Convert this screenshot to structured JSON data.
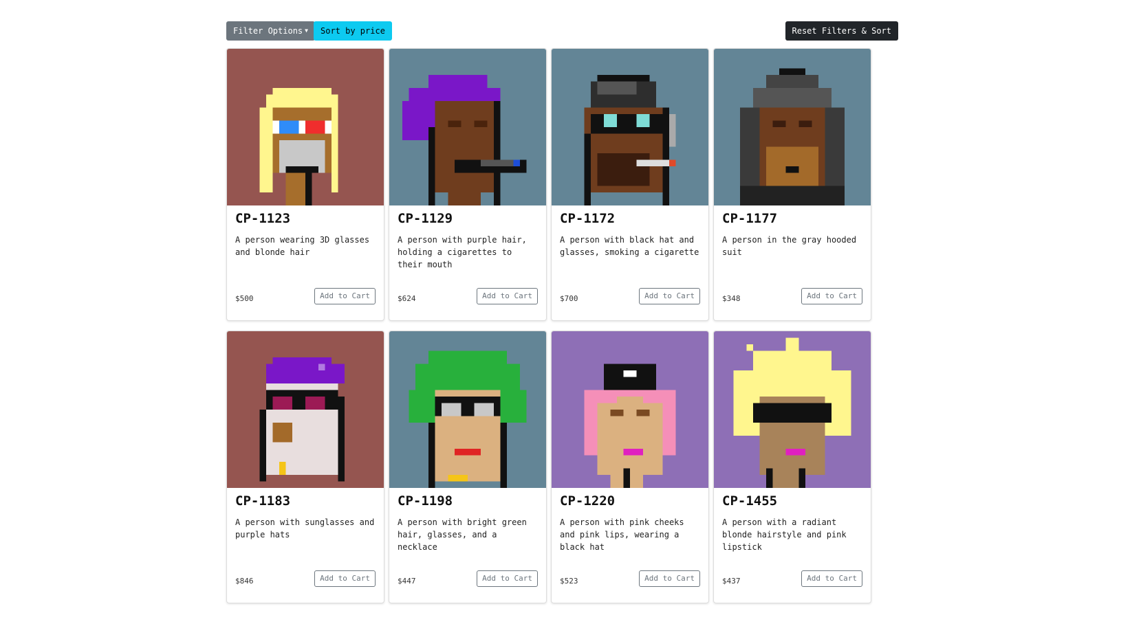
{
  "toolbar": {
    "filter_label": "Filter Options",
    "sort_label": "Sort by price",
    "reset_label": "Reset Filters & Sort"
  },
  "cards": [
    {
      "title": "CP-1123",
      "description": "A person wearing 3D glasses and blonde hair",
      "price": "$500",
      "button": "Add to Cart",
      "bg": "#955550"
    },
    {
      "title": "CP-1129",
      "description": "A person with purple hair, holding a cigarettes to their mouth",
      "price": "$624",
      "button": "Add to Cart",
      "bg": "#638596"
    },
    {
      "title": "CP-1172",
      "description": "A person with black hat and glasses, smoking a cigarette",
      "price": "$700",
      "button": "Add to Cart",
      "bg": "#638596"
    },
    {
      "title": "CP-1177",
      "description": "A person in the gray hooded suit",
      "price": "$348",
      "button": "Add to Cart",
      "bg": "#638596"
    },
    {
      "title": "CP-1183",
      "description": "A person with sunglasses and purple hats",
      "price": "$846",
      "button": "Add to Cart",
      "bg": "#955550"
    },
    {
      "title": "CP-1198",
      "description": "A person with bright green hair, glasses, and a necklace",
      "price": "$447",
      "button": "Add to Cart",
      "bg": "#638596"
    },
    {
      "title": "CP-1220",
      "description": "A person with pink cheeks and pink lips, wearing a black hat",
      "price": "$523",
      "button": "Add to Cart",
      "bg": "#8e6fb6"
    },
    {
      "title": "CP-1455",
      "description": "A person with a radiant blonde hairstyle and pink lipstick",
      "price": "$437",
      "button": "Add to Cart",
      "bg": "#8e6fb6"
    }
  ]
}
